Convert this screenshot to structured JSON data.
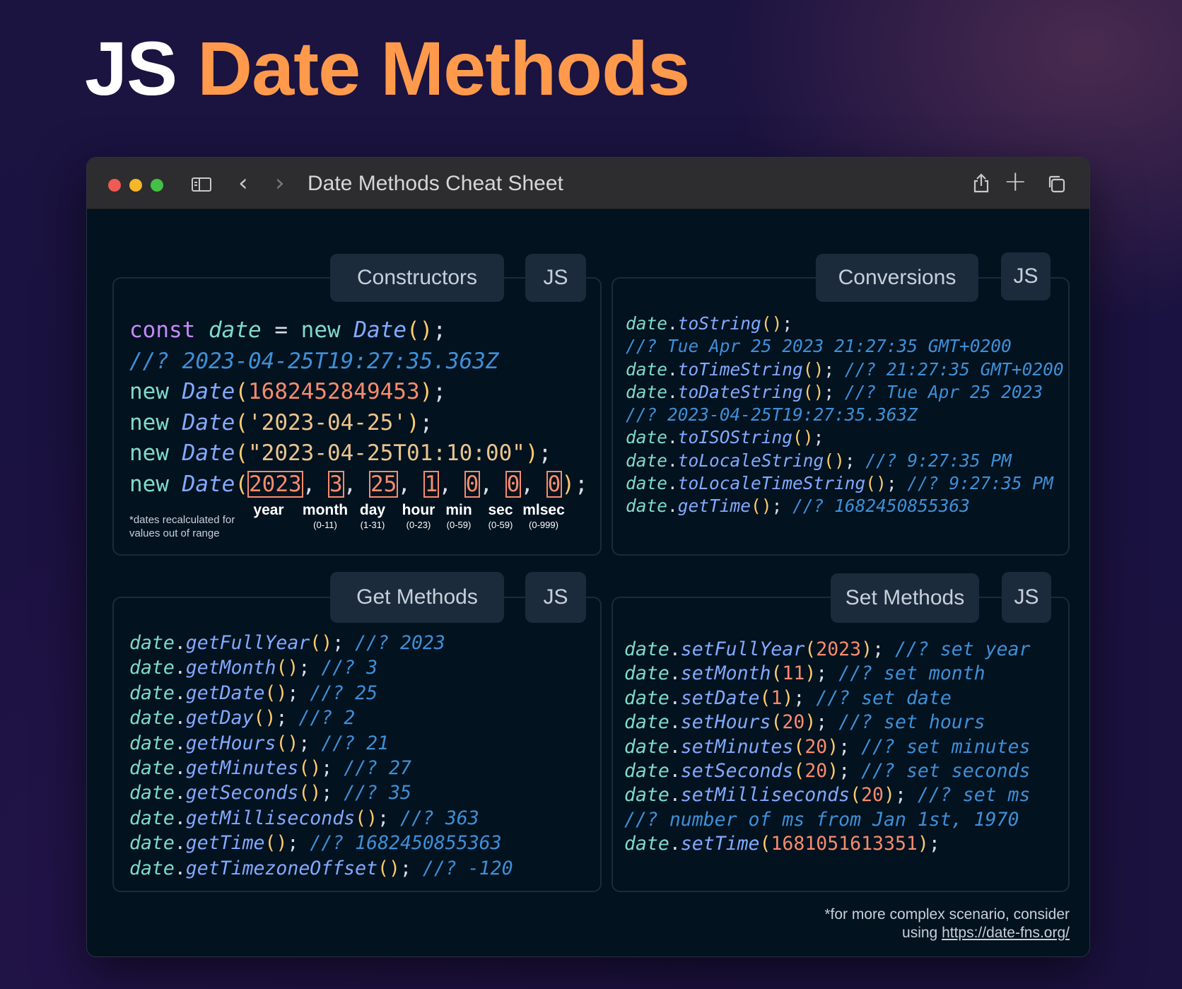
{
  "heading": {
    "prefix": "JS",
    "main": "Date Methods"
  },
  "window": {
    "title": "Date Methods Cheat Sheet"
  },
  "panels": {
    "constructors": {
      "title": "Constructors",
      "lang": "JS"
    },
    "conversions": {
      "title": "Conversions",
      "lang": "JS"
    },
    "get_methods": {
      "title": "Get Methods",
      "lang": "JS"
    },
    "set_methods": {
      "title": "Set Methods",
      "lang": "JS"
    }
  },
  "constructors": {
    "l1_const": "const",
    "l1_var": "date",
    "l1_eq": " = ",
    "l1_new": "new",
    "l1_fn": "Date",
    "l2_comment": "//? 2023-04-25T19:27:35.363Z",
    "l3_arg": "1682452849453",
    "l4_arg": "'2023-04-25'",
    "l5_arg": "\"2023-04-25T01:10:00\"",
    "l6_args": [
      "2023",
      "3",
      "25",
      "1",
      "0",
      "0",
      "0"
    ],
    "new": "new",
    "fn": "Date",
    "labels": [
      {
        "name": "year",
        "range": ""
      },
      {
        "name": "month",
        "range": "(0-11)"
      },
      {
        "name": "day",
        "range": "(1-31)"
      },
      {
        "name": "hour",
        "range": "(0-23)"
      },
      {
        "name": "min",
        "range": "(0-59)"
      },
      {
        "name": "sec",
        "range": "(0-59)"
      },
      {
        "name": "mlsec",
        "range": "(0-999)"
      }
    ],
    "note_line1": "*dates recalculated for",
    "note_line2": "values out of range"
  },
  "conversions": {
    "lines": [
      {
        "method": "toString",
        "comment": ""
      },
      {
        "method": "",
        "comment": "//? Tue Apr 25 2023 21:27:35 GMT+0200"
      },
      {
        "method": "toTimeString",
        "comment": "//? 21:27:35 GMT+0200"
      },
      {
        "method": "toDateString",
        "comment": "//? Tue Apr 25 2023"
      },
      {
        "method": "",
        "comment": "//? 2023-04-25T19:27:35.363Z"
      },
      {
        "method": "toISOString",
        "comment": ""
      },
      {
        "method": "toLocaleString",
        "comment": "//? 9:27:35 PM"
      },
      {
        "method": "toLocaleTimeString",
        "comment": "//? 9:27:35 PM"
      },
      {
        "method": "getTime",
        "comment": "//? 1682450855363"
      }
    ]
  },
  "get_methods": {
    "lines": [
      {
        "method": "getFullYear",
        "comment": "//? 2023"
      },
      {
        "method": "getMonth",
        "comment": "//? 3"
      },
      {
        "method": "getDate",
        "comment": "//? 25"
      },
      {
        "method": "getDay",
        "comment": "//? 2"
      },
      {
        "method": "getHours",
        "comment": "//? 21"
      },
      {
        "method": "getMinutes",
        "comment": "//? 27"
      },
      {
        "method": "getSeconds",
        "comment": "//? 35"
      },
      {
        "method": "getMilliseconds",
        "comment": "//? 363"
      },
      {
        "method": "getTime",
        "comment": "//? 1682450855363"
      },
      {
        "method": "getTimezoneOffset",
        "comment": "//? -120"
      }
    ]
  },
  "set_methods": {
    "lines": [
      {
        "method": "setFullYear",
        "arg": "2023",
        "comment": "//? set year"
      },
      {
        "method": "setMonth",
        "arg": "11",
        "comment": "//? set month"
      },
      {
        "method": "setDate",
        "arg": "1",
        "comment": "//? set date"
      },
      {
        "method": "setHours",
        "arg": "20",
        "comment": "//? set hours"
      },
      {
        "method": "setMinutes",
        "arg": "20",
        "comment": "//? set minutes"
      },
      {
        "method": "setSeconds",
        "arg": "20",
        "comment": "//? set seconds"
      },
      {
        "method": "setMilliseconds",
        "arg": "20",
        "comment": "//? set ms"
      },
      {
        "method": "",
        "arg": "",
        "comment": "//? number of ms from Jan 1st, 1970"
      },
      {
        "method": "setTime",
        "arg": "1681051613351",
        "comment": ""
      }
    ]
  },
  "code_object": "date",
  "footer": {
    "line1": "*for more complex scenario, consider",
    "line2_prefix": "using ",
    "link": "https://date-fns.org/"
  },
  "colors": {
    "heading_accent": "#ff9a4d",
    "window_bg": "#02121f",
    "panel_header": "#1c2b3b",
    "comment": "#3f8fd6",
    "number": "#f78c6c",
    "string": "#ecc48d",
    "method": "#82aaff",
    "object": "#7fdbca"
  },
  "icons": [
    "sidebar-icon",
    "chevron-left-icon",
    "chevron-right-icon",
    "share-icon",
    "plus-icon",
    "tabs-icon"
  ]
}
